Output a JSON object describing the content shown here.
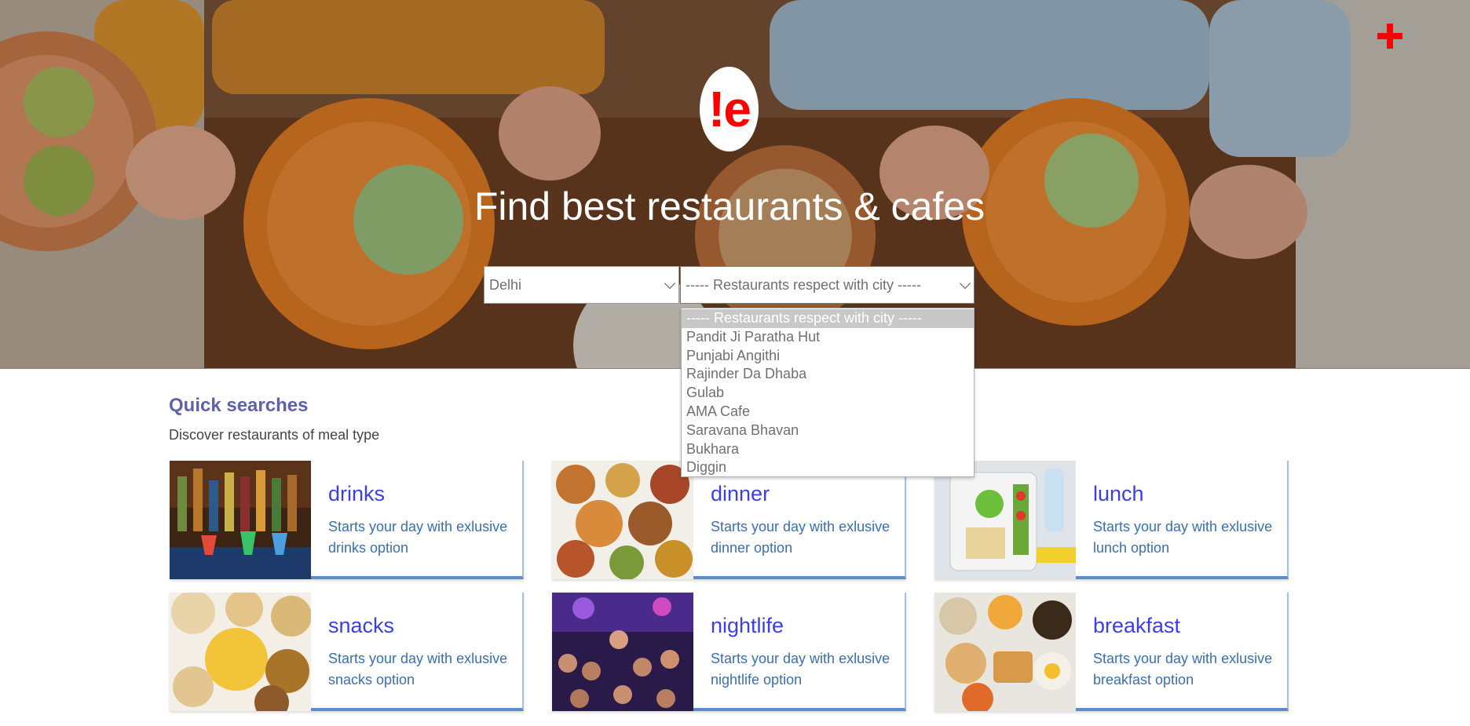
{
  "header": {
    "add_icon": "plus-icon",
    "logo_text": "!e",
    "title": "Find best restaurants & cafes"
  },
  "search": {
    "city_value": "Delhi",
    "restaurant_value": "----- Restaurants respect with city -----",
    "restaurant_options": [
      "----- Restaurants respect with city -----",
      "Pandit Ji Paratha Hut",
      "Punjabi Angithi",
      "Rajinder Da Dhaba",
      "Gulab",
      "AMA Cafe",
      "Saravana Bhavan",
      "Bukhara",
      "Diggin"
    ]
  },
  "quick": {
    "title": "Quick searches",
    "subtitle": "Discover restaurants of meal type",
    "cards": [
      {
        "title": "drinks",
        "desc": "Starts your day with exlusive drinks option"
      },
      {
        "title": "dinner",
        "desc": "Starts your day with exlusive dinner option"
      },
      {
        "title": "lunch",
        "desc": "Starts your day with exlusive lunch option"
      },
      {
        "title": "snacks",
        "desc": "Starts your day with exlusive snacks option"
      },
      {
        "title": "nightlife",
        "desc": "Starts your day with exlusive nightlife option"
      },
      {
        "title": "breakfast",
        "desc": "Starts your day with exlusive breakfast option"
      }
    ]
  },
  "colors": {
    "brand_red": "#ff0000",
    "heading_purple": "#5e62a8",
    "card_title": "#3c3ee6",
    "card_desc": "#3a6fb0",
    "card_accent": "#5b8ccb"
  }
}
